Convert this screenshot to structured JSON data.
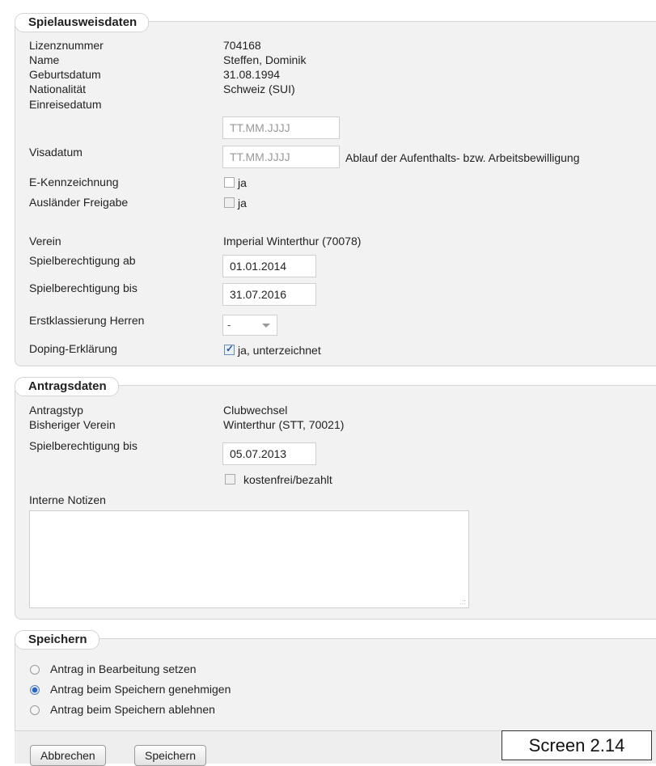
{
  "spielausweis": {
    "legend": "Spielausweisdaten",
    "lizenznummer": {
      "label": "Lizenznummer",
      "value": "704168"
    },
    "name": {
      "label": "Name",
      "value": "Steffen, Dominik"
    },
    "geburtsdatum": {
      "label": "Geburtsdatum",
      "value": "31.08.1994"
    },
    "nationalitaet": {
      "label": "Nationalität",
      "value": "Schweiz (SUI)"
    },
    "einreisedatum": {
      "label": "Einreisedatum",
      "placeholder": "TT.MM.JJJJ"
    },
    "visadatum": {
      "label": "Visadatum",
      "placeholder": "TT.MM.JJJJ",
      "hint": "Ablauf der Aufenthalts- bzw. Arbeitsbewilligung"
    },
    "e_kennzeichnung": {
      "label": "E-Kennzeichnung",
      "checkbox_label": "ja",
      "checked": false
    },
    "auslaender_freigabe": {
      "label": "Ausländer Freigabe",
      "checkbox_label": "ja",
      "checked": false
    },
    "verein": {
      "label": "Verein",
      "value": "Imperial Winterthur (70078)"
    },
    "spielberechtigung_ab": {
      "label": "Spielberechtigung ab",
      "value": "01.01.2014"
    },
    "spielberechtigung_bis": {
      "label": "Spielberechtigung bis",
      "value": "31.07.2016"
    },
    "erstklassierung": {
      "label": "Erstklassierung Herren",
      "selected": "-"
    },
    "doping": {
      "label": "Doping-Erklärung",
      "checkbox_label": "ja, unterzeichnet",
      "checked": true
    }
  },
  "antrag": {
    "legend": "Antragsdaten",
    "antragstyp": {
      "label": "Antragstyp",
      "value": "Clubwechsel"
    },
    "bisheriger_verein": {
      "label": "Bisheriger Verein",
      "value": "Winterthur (STT, 70021)"
    },
    "spielberechtigung_bis": {
      "label": "Spielberechtigung bis",
      "value": "05.07.2013"
    },
    "kostenfrei": {
      "checkbox_label": "kostenfrei/bezahlt",
      "checked": false
    },
    "notizen": {
      "label": "Interne Notizen",
      "value": ""
    }
  },
  "speichern": {
    "legend": "Speichern",
    "options": [
      {
        "label": "Antrag in Bearbeitung setzen",
        "selected": false
      },
      {
        "label": "Antrag beim Speichern genehmigen",
        "selected": true
      },
      {
        "label": "Antrag beim Speichern ablehnen",
        "selected": false
      }
    ]
  },
  "buttons": {
    "cancel": "Abbrechen",
    "save": "Speichern"
  },
  "screen_label": "Screen 2.14"
}
